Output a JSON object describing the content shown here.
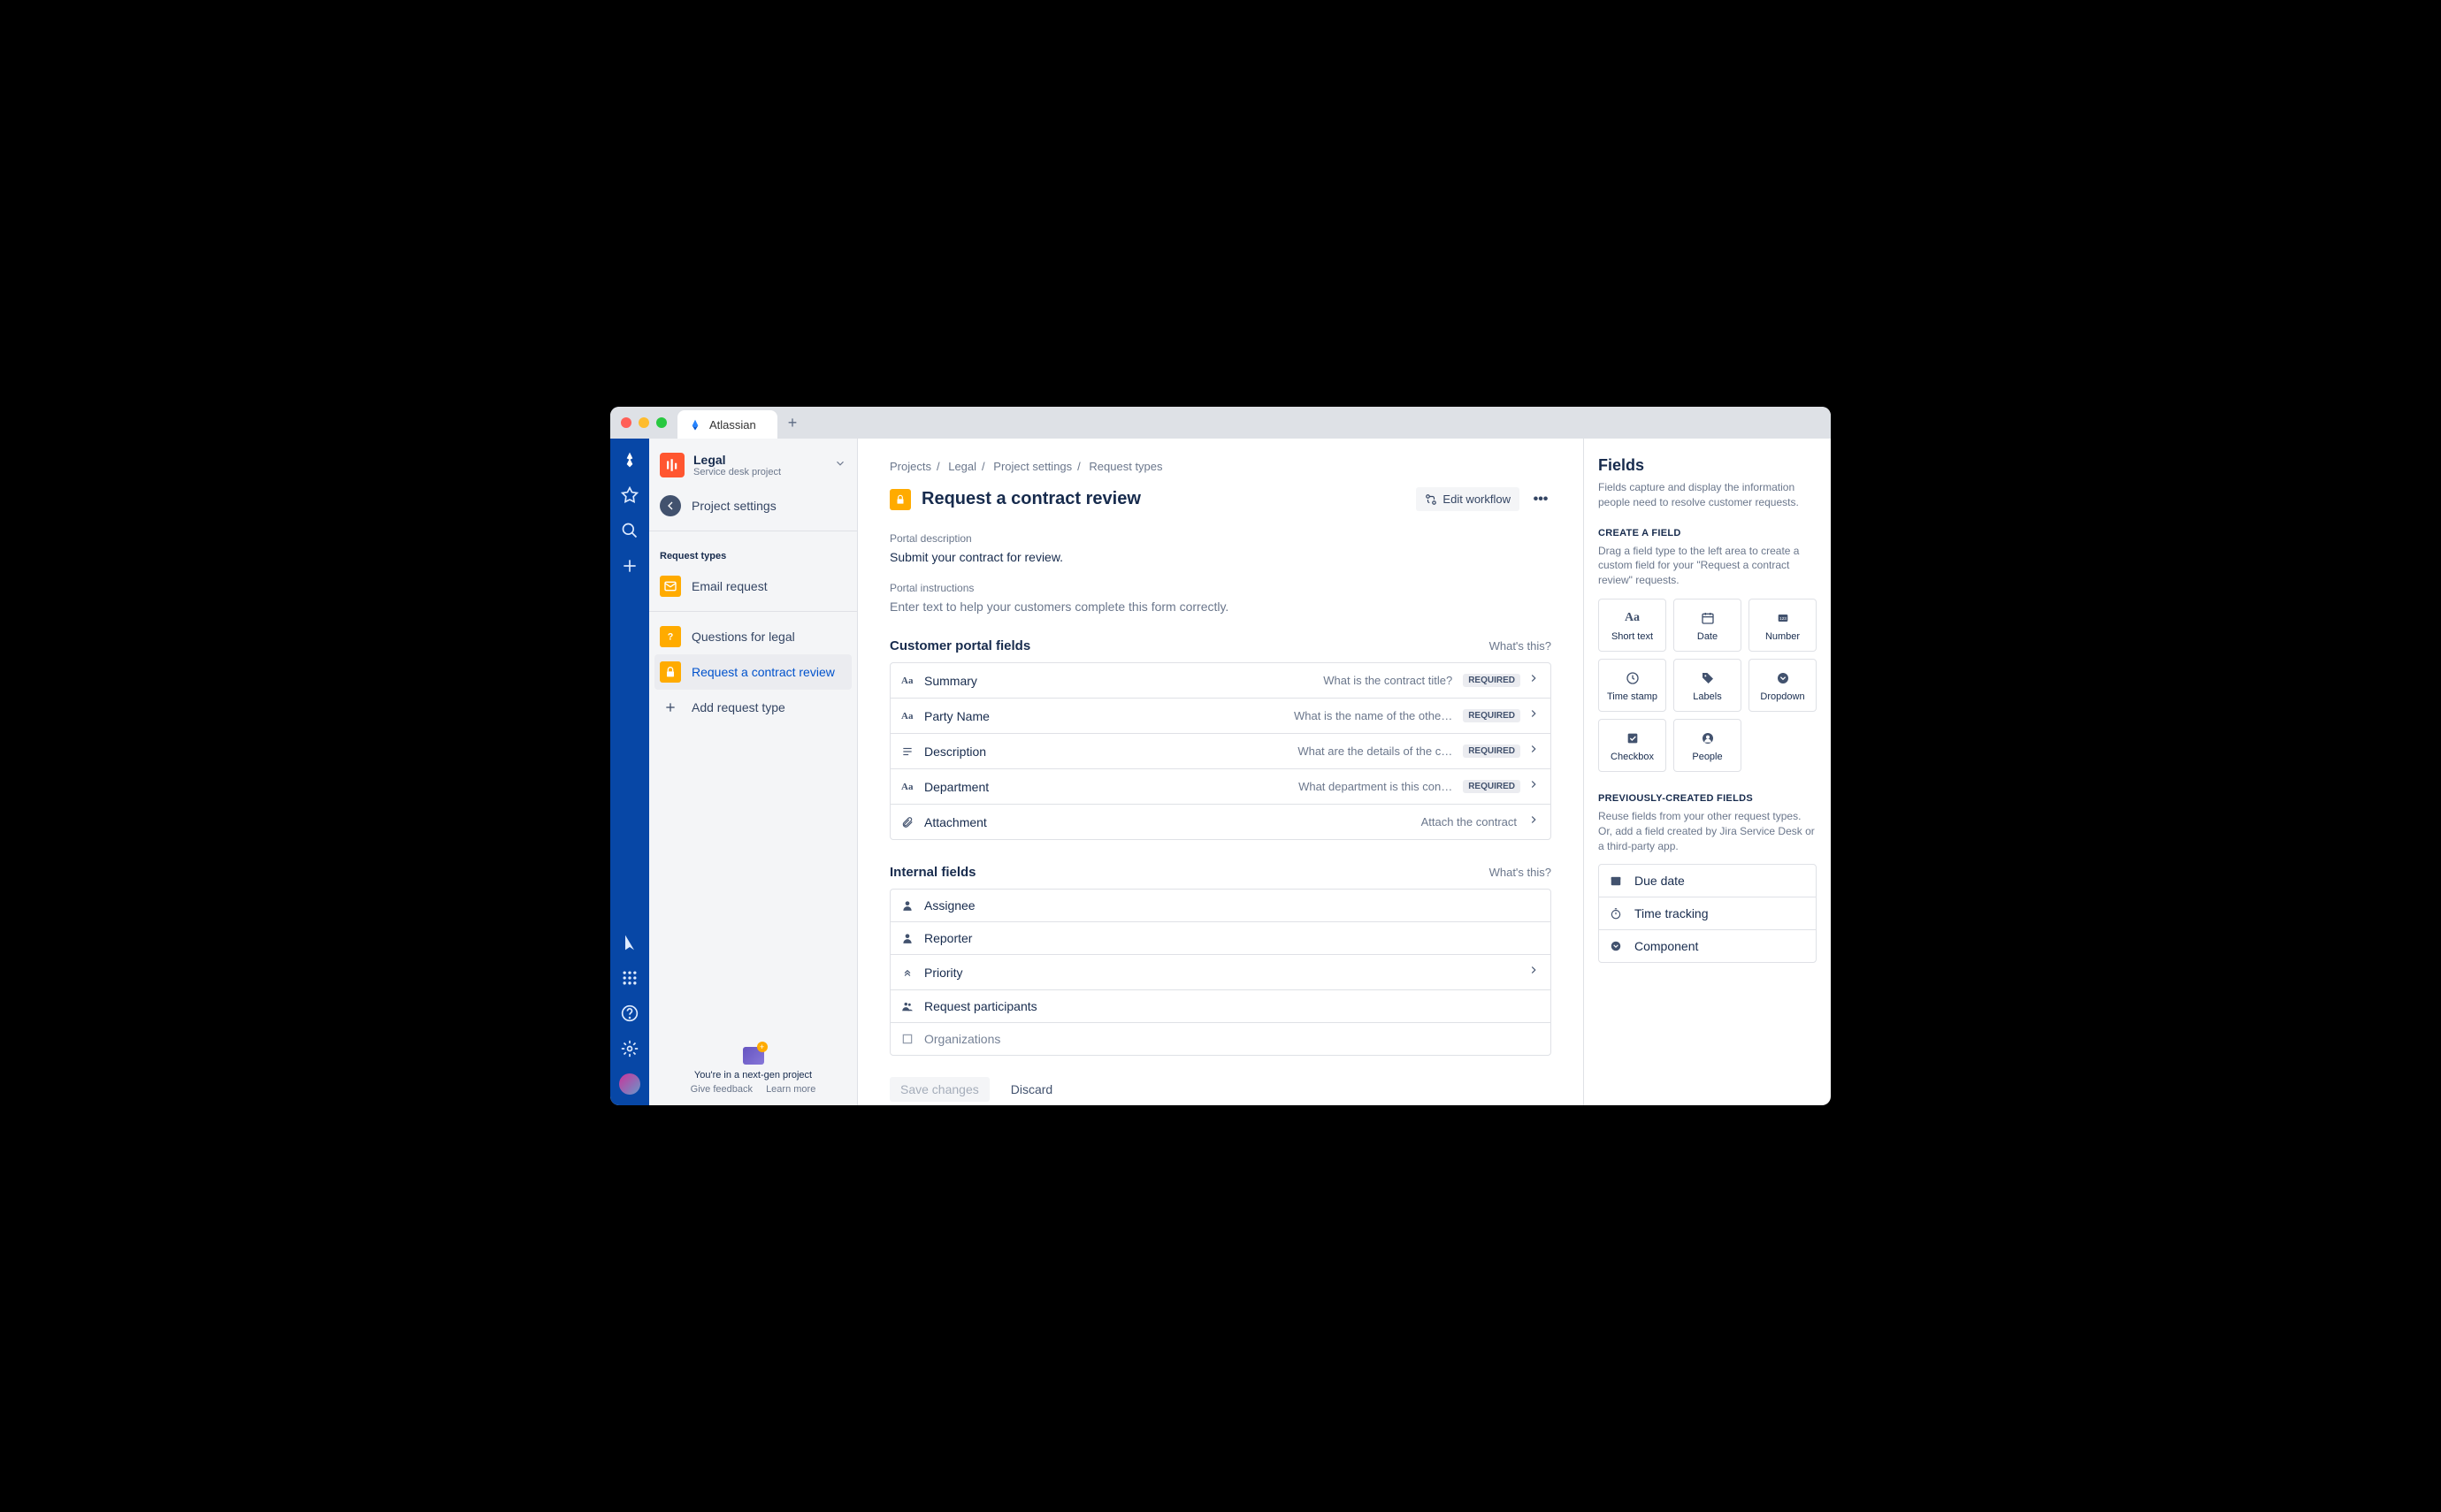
{
  "browser": {
    "tab_title": "Atlassian"
  },
  "sidebar": {
    "project_name": "Legal",
    "project_sub": "Service desk project",
    "settings_link": "Project settings",
    "request_types_hdr": "Request types",
    "email_request": "Email request",
    "questions": "Questions for legal",
    "contract_review": "Request a contract review",
    "add_request": "Add request type"
  },
  "footer": {
    "nextgen": "You're in a next-gen project",
    "feedback": "Give feedback",
    "learn": "Learn more"
  },
  "crumbs": {
    "projects": "Projects",
    "legal": "Legal",
    "settings": "Project settings",
    "types": "Request types"
  },
  "page": {
    "title": "Request a contract review",
    "edit_workflow": "Edit workflow",
    "portal_desc_lbl": "Portal description",
    "portal_desc": "Submit your contract for review.",
    "portal_instr_lbl": "Portal instructions",
    "portal_instr": "Enter text to help your customers complete this form correctly.",
    "customer_fields_title": "Customer portal fields",
    "internal_fields_title": "Internal fields",
    "whats_this": "What's this?",
    "save": "Save changes",
    "discard": "Discard",
    "required": "REQUIRED"
  },
  "customer_fields": [
    {
      "name": "Summary",
      "help": "What is the contract title?",
      "required": true,
      "chev": true
    },
    {
      "name": "Party Name",
      "help": "What is the name of the othe…",
      "required": true,
      "chev": true
    },
    {
      "name": "Description",
      "help": "What are the details of the c…",
      "required": true,
      "chev": true
    },
    {
      "name": "Department",
      "help": "What department is this con…",
      "required": true,
      "chev": true
    },
    {
      "name": "Attachment",
      "help": "Attach the contract",
      "required": false,
      "chev": true
    }
  ],
  "internal_fields": [
    {
      "name": "Assignee"
    },
    {
      "name": "Reporter"
    },
    {
      "name": "Priority",
      "chev": true
    },
    {
      "name": "Request participants"
    },
    {
      "name": "Organizations"
    }
  ],
  "right": {
    "title": "Fields",
    "desc": "Fields capture and display the information people need to resolve customer requests.",
    "create_hdr": "CREATE A FIELD",
    "create_sub": "Drag a field type to the left area to create a custom field for your \"Request a contract review\" requests.",
    "types": [
      {
        "label": "Short text"
      },
      {
        "label": "Date"
      },
      {
        "label": "Number"
      },
      {
        "label": "Time stamp"
      },
      {
        "label": "Labels"
      },
      {
        "label": "Dropdown"
      },
      {
        "label": "Checkbox"
      },
      {
        "label": "People"
      }
    ],
    "prev_hdr": "PREVIOUSLY-CREATED FIELDS",
    "prev_sub": "Reuse fields from your other request types. Or, add a field created by Jira Service Desk or a third-party app.",
    "prev": [
      {
        "name": "Due date"
      },
      {
        "name": "Time tracking"
      },
      {
        "name": "Component"
      }
    ]
  }
}
